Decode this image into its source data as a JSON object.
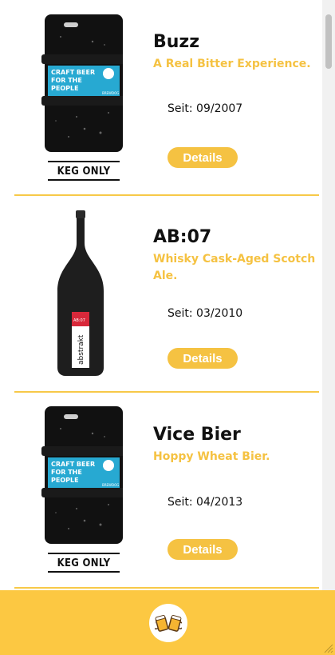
{
  "beers": [
    {
      "name": "Buzz",
      "tagline": "A Real Bitter Experience.",
      "since": "Seit: 09/2007",
      "details": "Details",
      "image_type": "keg",
      "keg_label": "KEG ONLY",
      "keg_text": [
        "CRAFT BEER",
        "FOR THE",
        "PEOPLE"
      ],
      "keg_brand": "BREWDOG"
    },
    {
      "name": "AB:07",
      "tagline": "Whisky Cask-Aged Scotch Ale.",
      "since": "Seit: 03/2010",
      "details": "Details",
      "image_type": "bottle",
      "bottle_label": "abstrakt",
      "bottle_code": "AB:07"
    },
    {
      "name": "Vice Bier",
      "tagline": "Hoppy Wheat Bier.",
      "since": "Seit: 04/2013",
      "details": "Details",
      "image_type": "keg",
      "keg_label": "KEG ONLY",
      "keg_text": [
        "CRAFT BEER",
        "FOR THE",
        "PEOPLE"
      ],
      "keg_brand": "BREWDOG"
    }
  ],
  "footer": {
    "icon": "beer-mugs-cheers-icon"
  },
  "colors": {
    "accent": "#f5c242",
    "footer": "#fcc842",
    "text": "#111111"
  }
}
